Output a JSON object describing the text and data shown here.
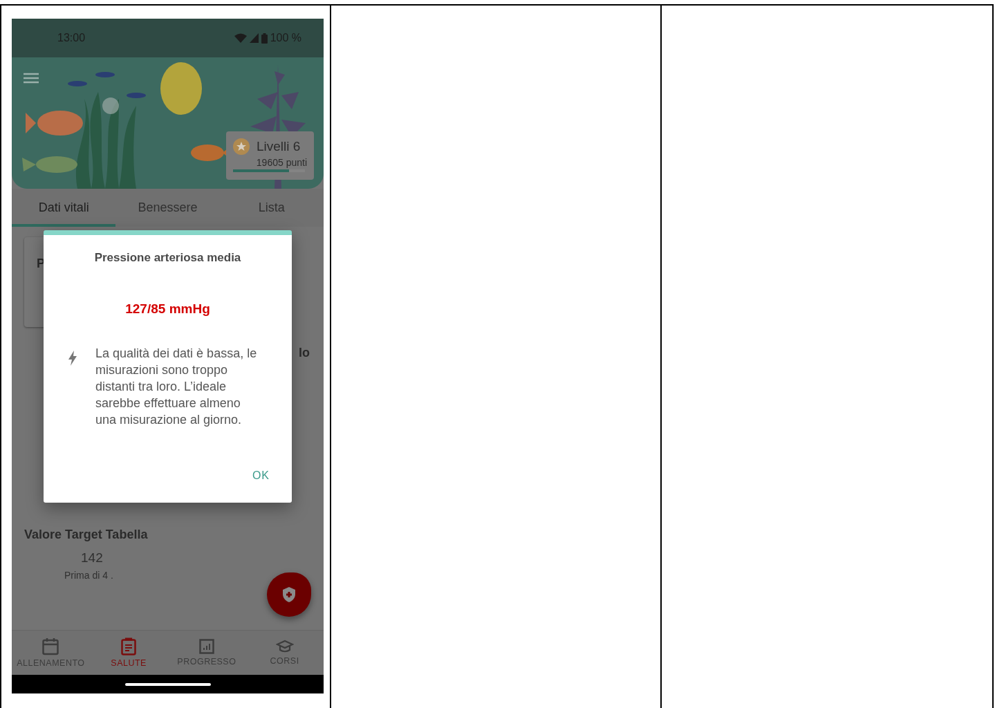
{
  "status_bar": {
    "time": "13:00",
    "battery": "100 %"
  },
  "header": {
    "level_badge": {
      "title": "Livelli 6",
      "points": "19605 punti",
      "level": 0.78
    }
  },
  "tabs": [
    {
      "label": "Dati vitali",
      "selected": true
    },
    {
      "label": "Benessere",
      "selected": false
    },
    {
      "label": "Lista",
      "selected": false
    }
  ],
  "content": {
    "card_title": "P",
    "side_text": "lo",
    "target": {
      "title": "Valore Target Tabella",
      "value": "142",
      "note": "Prima di 4 ."
    }
  },
  "dialog": {
    "title": "Pressione arteriosa media",
    "value": "127/85 mmHg",
    "message": "La qualità dei dati è bassa, le misurazioni sono troppo distanti tra loro. L’ideale sarebbe effettuare almeno una misurazione al giorno.",
    "button": "OK"
  },
  "bottom_nav": [
    {
      "label": "ALLENAMENTO",
      "kind": "calendar",
      "selected": false
    },
    {
      "label": "SALUTE",
      "kind": "clipboard",
      "selected": true
    },
    {
      "label": "PROGRESSO",
      "kind": "chart",
      "selected": false
    },
    {
      "label": "CORSI",
      "kind": "cap",
      "selected": false
    }
  ]
}
